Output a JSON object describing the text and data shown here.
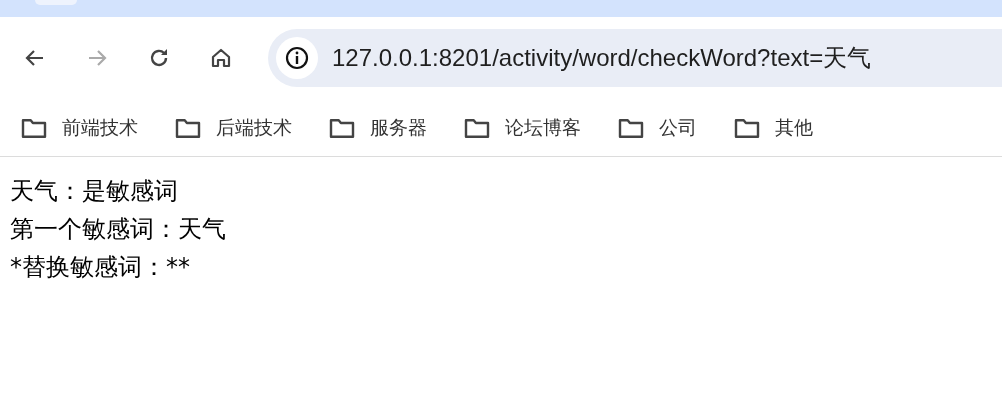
{
  "address_bar": {
    "url": "127.0.0.1:8201/activity/word/checkWord?text=天气"
  },
  "bookmarks": [
    {
      "label": "前端技术"
    },
    {
      "label": "后端技术"
    },
    {
      "label": "服务器"
    },
    {
      "label": "论坛博客"
    },
    {
      "label": "公司"
    },
    {
      "label": "其他"
    }
  ],
  "page_lines": [
    "天气：是敏感词",
    "第一个敏感词：天气",
    "*替换敏感词：**"
  ]
}
